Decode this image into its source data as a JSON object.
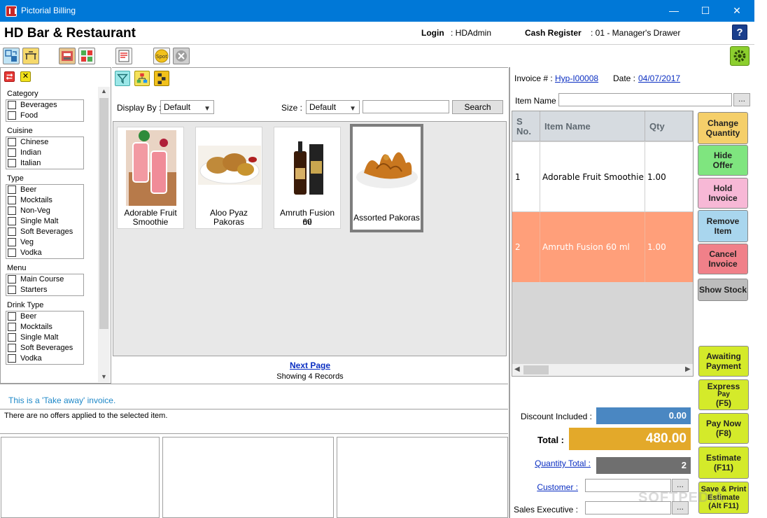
{
  "window": {
    "title": "Pictorial Billing",
    "controls": {
      "minimize": "—",
      "maximize": "☐",
      "close": "✕"
    }
  },
  "header": {
    "company": "HD Bar & Restaurant",
    "login_label": "Login",
    "login_value": ": HDAdmin",
    "register_label": "Cash Register",
    "register_value": ": 01 - Manager's Drawer",
    "help": "?"
  },
  "toolbar": {
    "spot_icon_text": "Spot"
  },
  "filters": {
    "groups": [
      {
        "title": "Category",
        "items": [
          "Beverages",
          "Food"
        ]
      },
      {
        "title": "Cuisine",
        "items": [
          "Chinese",
          "Indian",
          "Italian"
        ]
      },
      {
        "title": "Type",
        "items": [
          "Beer",
          "Mocktails",
          "Non-Veg",
          "Single Malt",
          "Soft Beverages",
          "Veg",
          "Vodka"
        ]
      },
      {
        "title": "Menu",
        "items": [
          "Main Course",
          "Starters"
        ]
      },
      {
        "title": "Drink Type",
        "items": [
          "Beer",
          "Mocktails",
          "Single Malt",
          "Soft Beverages",
          "Vodka"
        ]
      }
    ]
  },
  "catalog": {
    "display_by_label": "Display By :",
    "display_by_value": "Default",
    "size_label": "Size :",
    "size_value": "Default",
    "search_value": "",
    "search_button": "Search",
    "products": [
      {
        "name_line1": "Adorable Fruit",
        "name_line2": "Smoothie"
      },
      {
        "name_line1": "Aloo Pyaz",
        "name_line2": "Pakoras"
      },
      {
        "name_line1": "Amruth Fusion 60",
        "name_line2": "ml"
      },
      {
        "name_line1": "Assorted Pakoras",
        "name_line2": ""
      }
    ],
    "next_page": "Next Page",
    "showing": "Showing 4 Records"
  },
  "messages": {
    "takeaway": "This is a 'Take away' invoice.",
    "offers": "There are no offers applied to the selected item."
  },
  "invoice": {
    "invoice_label": "Invoice # :",
    "invoice_no": "Hyp-I00008",
    "date_label": "Date :",
    "date_value": "04/07/2017",
    "item_name_label": "Item Name :",
    "item_name_value": "",
    "ellipsis": "...",
    "columns": {
      "sno_line1": "S",
      "sno_line2": "No.",
      "item": "Item Name",
      "qty": "Qty"
    },
    "rows": [
      {
        "sno": "1",
        "item": "Adorable Fruit Smoothie",
        "qty": "1.00",
        "color": "#ffffff"
      },
      {
        "sno": "2",
        "item": "Amruth Fusion 60 ml",
        "qty": "1.00",
        "color": "#ff9f7a"
      }
    ]
  },
  "actions": {
    "change_qty_1": "Change",
    "change_qty_2": "Quantity",
    "hide_offer_1": "Hide",
    "hide_offer_2": "Offer",
    "hold_1": "Hold",
    "hold_2": "Invoice",
    "remove_1": "Remove",
    "remove_2": "Item",
    "cancel_1": "Cancel",
    "cancel_2": "Invoice",
    "show_stock": "Show Stock",
    "awaiting_1": "Awaiting",
    "awaiting_2": "Payment",
    "express_1": "Express",
    "express_2": "Pay",
    "express_3": "(F5)",
    "paynow_1": "Pay Now",
    "paynow_2": "(F8)",
    "estimate_1": "Estimate",
    "estimate_2": "(F11)",
    "saveprint_1": "Save & Print",
    "saveprint_2": "Estimate",
    "saveprint_3": "(Alt F11)"
  },
  "totals": {
    "discount_label": "Discount Included :",
    "discount_value": "0.00",
    "total_label": "Total :",
    "total_value": "480.00",
    "qty_label": "Quantity Total :",
    "qty_value": "2",
    "customer_label": "Customer :",
    "customer_value": "",
    "sales_exec_label": "Sales Executive :",
    "sales_exec_value": ""
  },
  "colors": {
    "titlebar": "#0078d7",
    "discount_box": "#4a87c2",
    "total_box": "#e3a92a",
    "qty_box": "#6f6f6f",
    "highlight_row": "#ff9f7a"
  },
  "watermark": "SOFTPEDIA"
}
